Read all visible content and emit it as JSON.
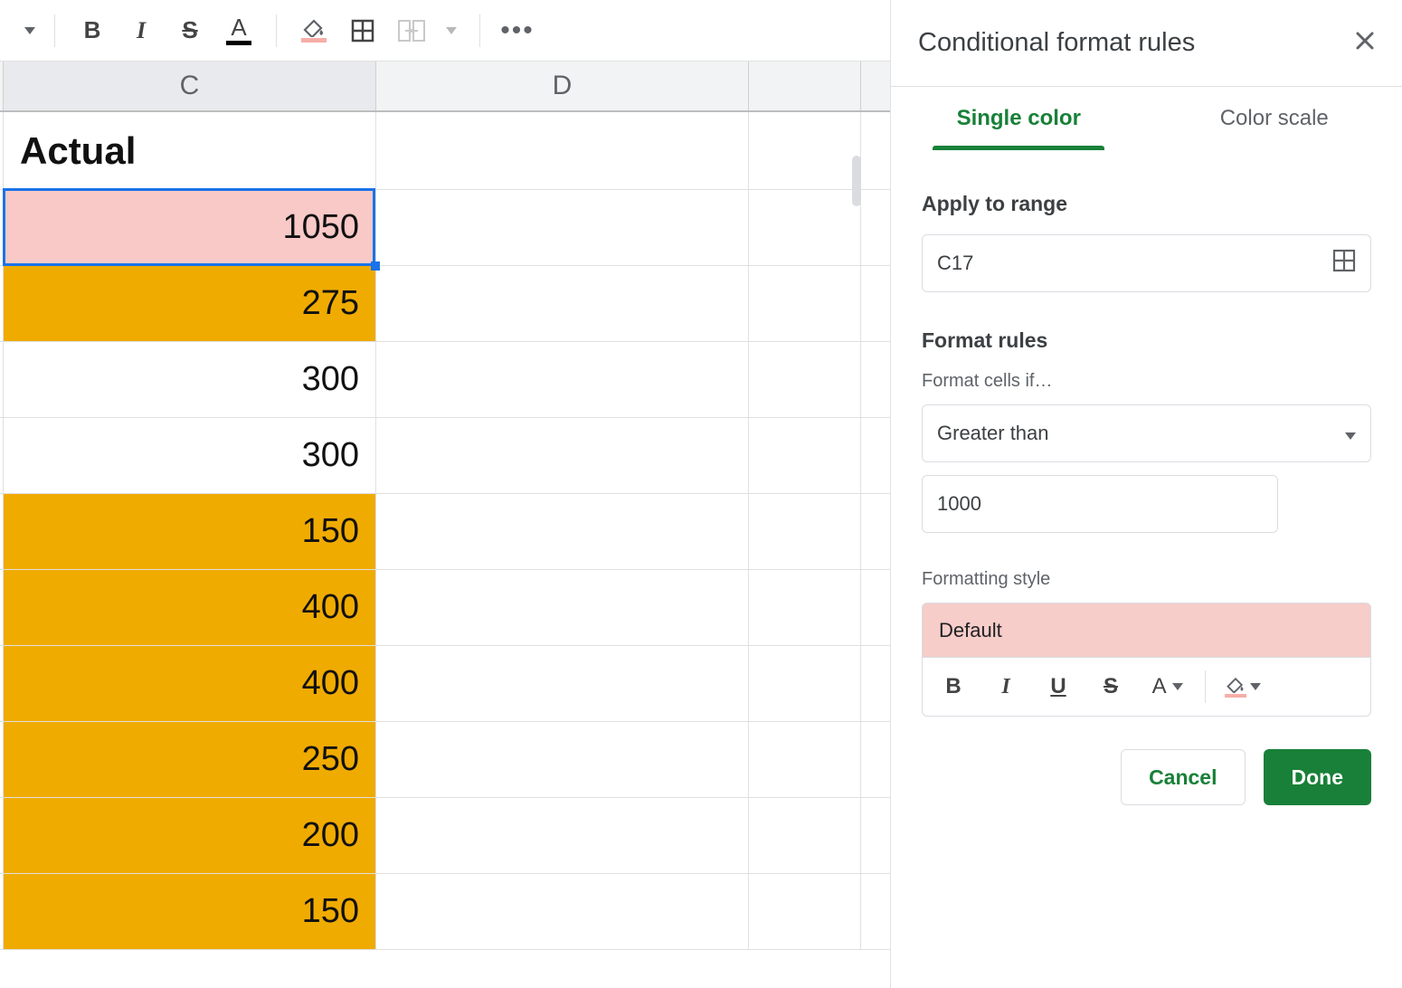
{
  "toolbar": {
    "bold": "B",
    "italic": "I",
    "strike": "S",
    "textcolor": "A"
  },
  "columns": {
    "C": "C",
    "D": "D"
  },
  "sheet": {
    "header": "Actual",
    "rows": [
      {
        "value": "1050",
        "bg": "pink",
        "active": true
      },
      {
        "value": "275",
        "bg": "amber"
      },
      {
        "value": "300",
        "bg": "white"
      },
      {
        "value": "300",
        "bg": "white"
      },
      {
        "value": "150",
        "bg": "amber"
      },
      {
        "value": "400",
        "bg": "amber"
      },
      {
        "value": "400",
        "bg": "amber"
      },
      {
        "value": "250",
        "bg": "amber"
      },
      {
        "value": "200",
        "bg": "amber"
      },
      {
        "value": "150",
        "bg": "amber"
      }
    ]
  },
  "panel": {
    "title": "Conditional format rules",
    "tabs": {
      "single": "Single color",
      "scale": "Color scale"
    },
    "apply_label": "Apply to range",
    "range_value": "C17",
    "rules_label": "Format rules",
    "cells_if_label": "Format cells if…",
    "condition": "Greater than",
    "threshold": "1000",
    "style_label": "Formatting style",
    "style_preview": "Default",
    "cancel": "Cancel",
    "done": "Done"
  }
}
